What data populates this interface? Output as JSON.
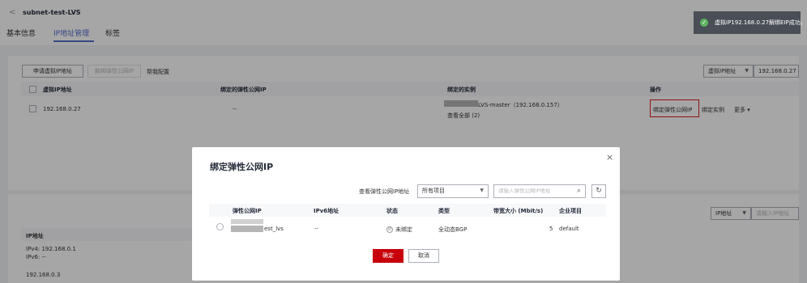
{
  "header": {
    "back_glyph": "<",
    "title": "subnet-test-LVS"
  },
  "tabs": [
    {
      "label": "基本信息"
    },
    {
      "label": "IP地址管理"
    },
    {
      "label": "标签"
    }
  ],
  "toast": {
    "message": "虚拟IP192.168.0.27解绑EIP成功。",
    "icon": "check-circle-icon",
    "color": "#5fb462"
  },
  "toolbar": {
    "apply_vip": "申请虚拟IP地址",
    "unbind_eip": "解绑弹性公网IP",
    "feedback": "帮我配置",
    "filter_select": "虚拟IP地址",
    "filter_value": "192.168.0.27"
  },
  "table": {
    "headers": [
      "虚拟IP地址",
      "绑定的弹性公网IP",
      "绑定的实例",
      "操作"
    ],
    "row": {
      "ip": "192.168.0.27",
      "eip": "--",
      "instance": "LVS-master（192.168.0.157）",
      "view_all": "查看全部 (2)",
      "actions": [
        "绑定弹性公网IP",
        "绑定实例",
        "更多"
      ]
    }
  },
  "lower_panel": {
    "filter_select": "IP地址",
    "filter_placeholder": "请输入IP地址",
    "header": "IP地址",
    "rows": [
      "IPv4: 192.168.0.1",
      "IPv6: --",
      "192.168.0.3"
    ]
  },
  "modal": {
    "title": "绑定弹性公网IP",
    "close_glyph": "×",
    "view_link": "查看弹性公网IP地址",
    "project_select": "所有项目",
    "search_placeholder": "请输入弹性公网IP地址",
    "headers": [
      "弹性公网IP",
      "IPv6地址",
      "状态",
      "类型",
      "带宽大小 (Mbit/s)",
      "企业项目"
    ],
    "row": {
      "name": "est_lvs",
      "ipv6": "--",
      "status": "未绑定",
      "type": "全动态BGP",
      "bandwidth": "5",
      "project": "default"
    },
    "ok_label": "确定",
    "cancel_label": "取消"
  },
  "colors": {
    "primary": "#526ecc",
    "danger": "#c7000b",
    "highlight_border": "#e02020"
  }
}
